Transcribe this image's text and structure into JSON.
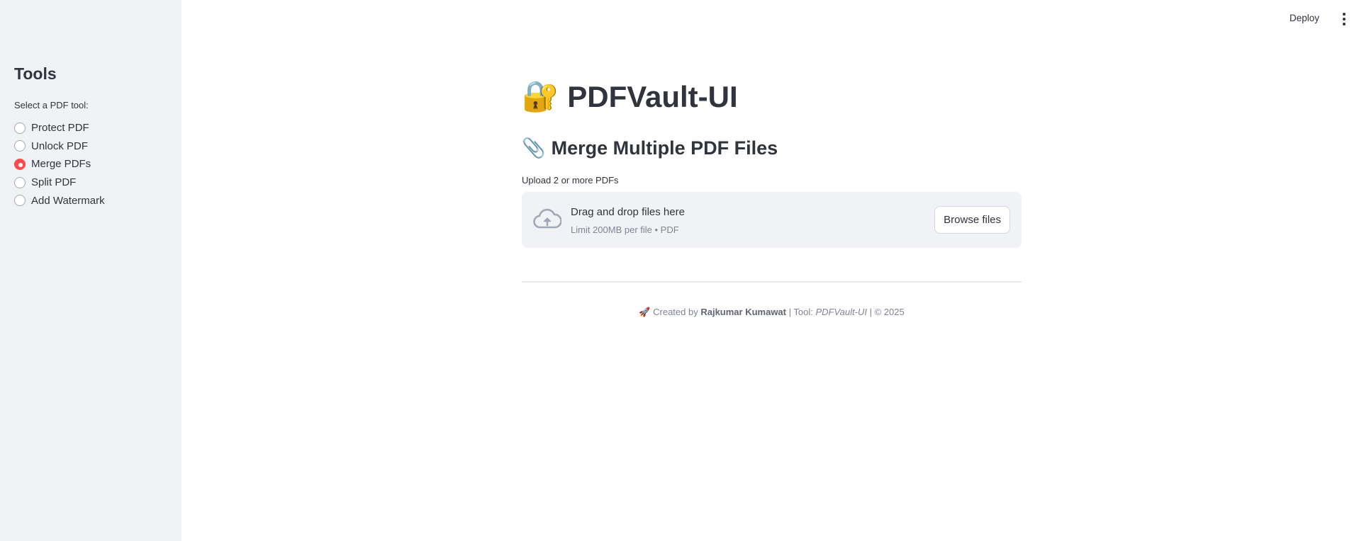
{
  "header": {
    "deploy_label": "Deploy",
    "menu_icon": "kebab-menu-icon"
  },
  "sidebar": {
    "title": "Tools",
    "radio_label": "Select a PDF tool:",
    "options": [
      {
        "label": "Protect PDF",
        "selected": false
      },
      {
        "label": "Unlock PDF",
        "selected": false
      },
      {
        "label": "Merge PDFs",
        "selected": true
      },
      {
        "label": "Split PDF",
        "selected": false
      },
      {
        "label": "Add Watermark",
        "selected": false
      }
    ]
  },
  "main": {
    "title_emoji": "🔐",
    "title": "PDFVault-UI",
    "section_emoji": "📎",
    "section_title": "Merge Multiple PDF Files",
    "upload_label": "Upload 2 or more PDFs",
    "dropzone": {
      "icon": "cloud-upload-icon",
      "title": "Drag and drop files here",
      "subtitle": "Limit 200MB per file • PDF",
      "button_label": "Browse files"
    },
    "footer": {
      "emoji": "🚀",
      "prefix": "Created by",
      "author": "Rajkumar Kumawat",
      "tool_prefix": "| Tool:",
      "tool_name": "PDFVault-UI",
      "suffix": "| © 2025"
    }
  },
  "colors": {
    "accent": "#ff4b4b",
    "sidebar_bg": "#f0f2f6",
    "text": "#31333f",
    "muted": "#808495"
  }
}
